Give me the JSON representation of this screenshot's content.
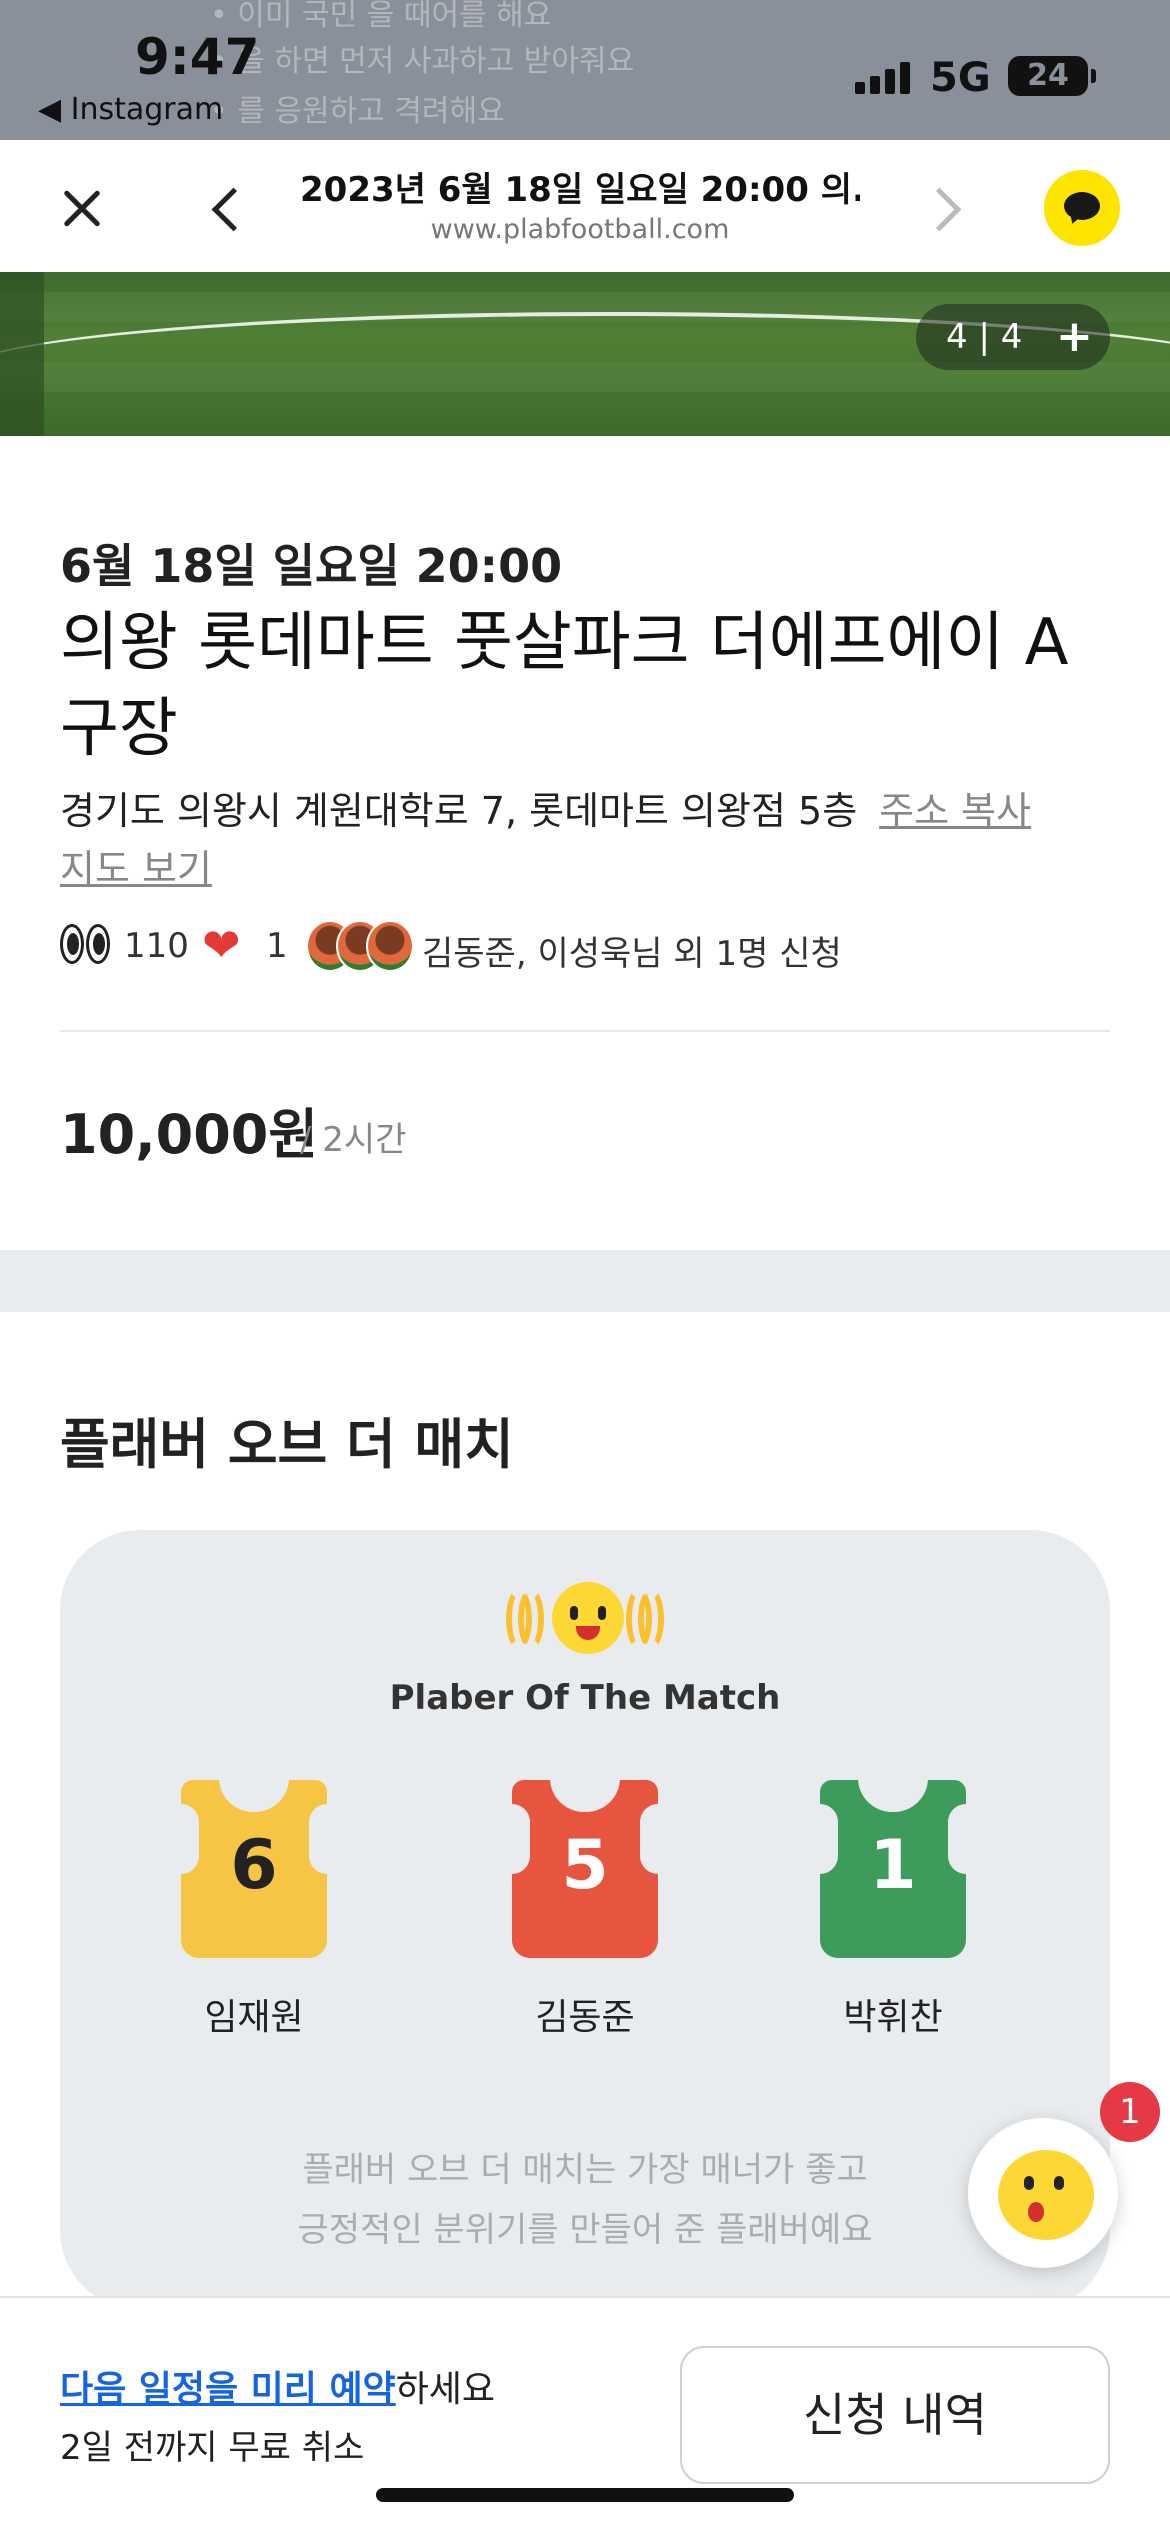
{
  "status_bar": {
    "time": "9:47",
    "back_app": "◀ Instagram",
    "network": "5G",
    "battery": "24",
    "ghost_lines": [
      "• 이미 국민 을 때어를 해요",
      "• 을 하면 먼저 사과하고 받아줘요",
      "• 를 응원하고 격려해요"
    ]
  },
  "browser": {
    "title": "2023년 6월 18일 일요일 20:00 의...",
    "url": "www.plabfootball.com"
  },
  "photo": {
    "counter": "4 | 4",
    "expand": "+"
  },
  "match": {
    "date": "6월 18일 일요일 20:00",
    "venue": "의왕 롯데마트 풋살파크 더에프에이 A구장",
    "address": "경기도 의왕시 계원대학로 7, 롯데마트 의왕점 5층",
    "copy_address": "주소 복사",
    "map_link": "지도 보기",
    "views": "110",
    "likes": "1",
    "applicants": "김동준, 이성욱님 외 1명 신청",
    "price": "10,000원",
    "duration": "/ 2시간"
  },
  "potm": {
    "section_title": "플래버 오브 더 매치",
    "label": "Plaber Of The Match",
    "players": [
      {
        "number": "6",
        "name": "임재원",
        "color": "#f6c544"
      },
      {
        "number": "5",
        "name": "김동준",
        "color": "#e8553f"
      },
      {
        "number": "1",
        "name": "박휘찬",
        "color": "#3d9b5c"
      }
    ],
    "desc_line1": "플래버 오브 더 매치는 가장 매너가 좋고",
    "desc_line2": "긍정적인 분위기를 만들어 준 플래버예요"
  },
  "chat_fab": {
    "badge": "1"
  },
  "bottom": {
    "reserve_link": "다음 일정을 미리 예약",
    "reserve_suffix": "하세요",
    "cancel_note": "2일 전까지 무료 취소",
    "history_button": "신청 내역"
  }
}
